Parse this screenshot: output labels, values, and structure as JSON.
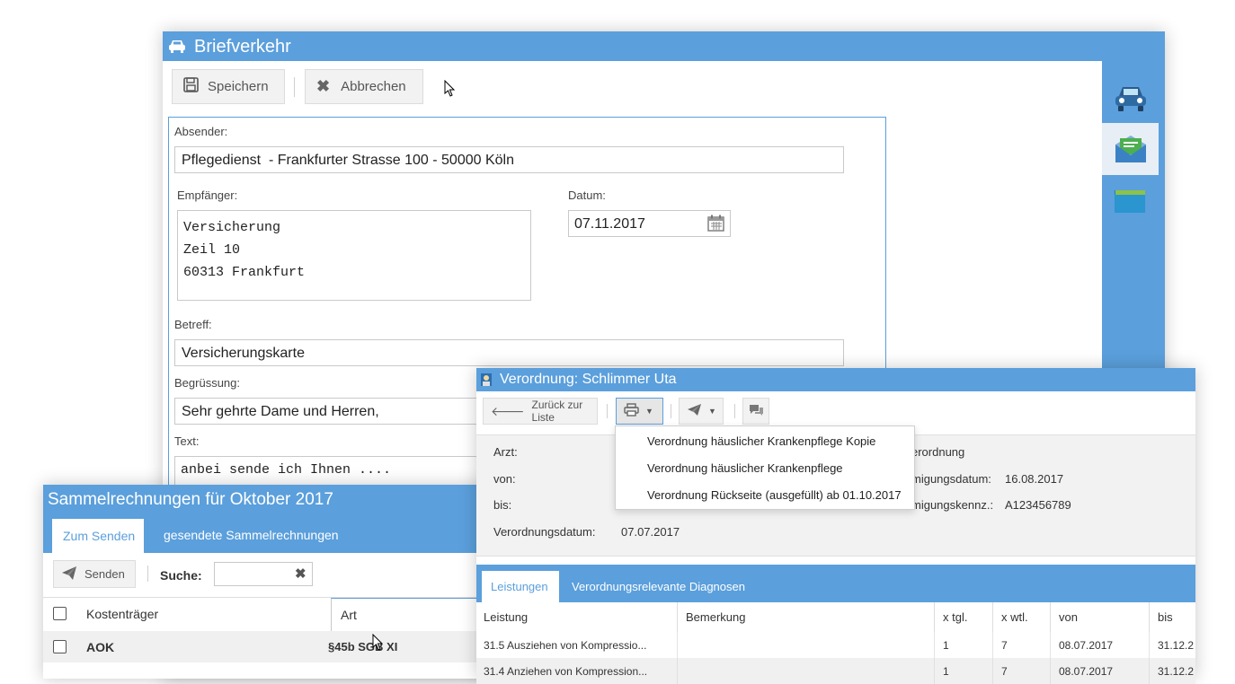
{
  "brief": {
    "title": "Briefverkehr",
    "save_label": "Speichern",
    "cancel_label": "Abbrechen",
    "absender_label": "Absender:",
    "absender_value": "Pflegedienst  - Frankfurter Strasse 100 - 50000 Köln",
    "empfaenger_label": "Empfänger:",
    "empfaenger_lines": [
      "Versicherung",
      "Zeil 10",
      "60313 Frankfurt"
    ],
    "datum_label": "Datum:",
    "datum_value": "07.11.2017",
    "betreff_label": "Betreff:",
    "betreff_value": "Versicherungskarte",
    "begruessung_label": "Begrüssung:",
    "begruessung_value": "Sehr gehrte Dame und Herren,",
    "text_label": "Text:",
    "text_value": "anbei sende ich Ihnen ...."
  },
  "side_icons": [
    "car-icon",
    "email-open-icon",
    "folder-icon"
  ],
  "sammel": {
    "title": "Sammelrechnungen für Oktober 2017",
    "tabs": [
      "Zum Senden",
      "gesendete Sammelrechnungen"
    ],
    "send_label": "Senden",
    "search_label": "Suche:",
    "search_value": "",
    "columns": [
      "Kostenträger",
      "Art"
    ],
    "rows": [
      {
        "kostentraeger": "AOK",
        "art": "§45b SGB XI"
      }
    ]
  },
  "verordnung": {
    "title": "Verordnung: Schlimmer Uta",
    "back_label": "Zurück zur Liste",
    "menu_items": [
      "Verordnung häuslicher Krankenpflege Kopie",
      "Verordnung häuslicher Krankenpflege",
      "Verordnung Rückseite (ausgefüllt) ab 01.10.2017"
    ],
    "arzt_label": "Arzt:",
    "von_label": "von:",
    "bis_label": "bis:",
    "verordnungsdatum_label": "Verordnungsdatum:",
    "verordnungsdatum_value": "07.07.2017",
    "right_col_1": "erordnung",
    "genehm_datum_label": "migungsdatum:",
    "genehm_datum_value": "16.08.2017",
    "genehm_kennz_label": "migungskennz.:",
    "genehm_kennz_value": "A123456789",
    "tabs": [
      "Leistungen",
      "Verordnungsrelevante Diagnosen"
    ],
    "columns": [
      "Leistung",
      "Bemerkung",
      "x tgl.",
      "x wtl.",
      "von",
      "bis"
    ],
    "rows": [
      {
        "leistung": "31.5 Ausziehen von Kompressio...",
        "bemerkung": "",
        "tgl": "1",
        "wtl": "7",
        "von": "08.07.2017",
        "bis": "31.12.2"
      },
      {
        "leistung": "31.4 Anziehen von Kompression...",
        "bemerkung": "",
        "tgl": "1",
        "wtl": "7",
        "von": "08.07.2017",
        "bis": "31.12.2"
      }
    ]
  },
  "colors": {
    "accent": "#5b9fdc",
    "side_bar": "#5b9fdc",
    "row_alt": "#f0f0f0"
  }
}
